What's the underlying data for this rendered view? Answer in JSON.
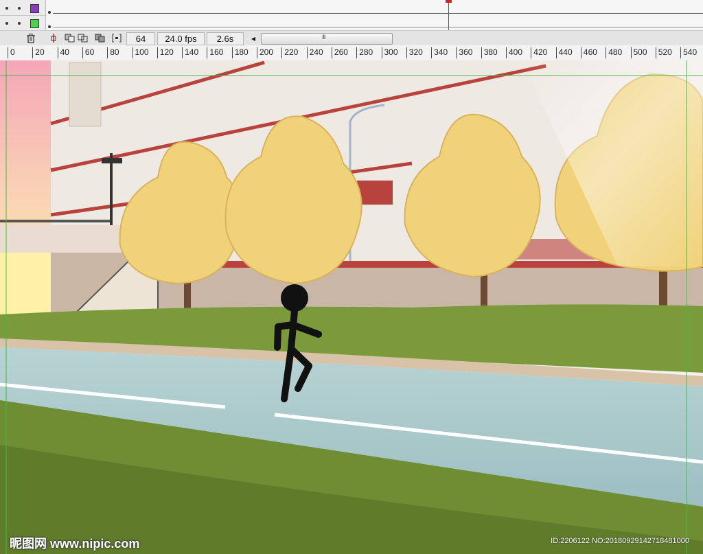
{
  "timeline": {
    "layers": [
      {
        "color": "#8b3bbd"
      },
      {
        "color": "#4bd34b"
      }
    ],
    "current_frame": "64",
    "frame_rate": "24.0 fps",
    "elapsed_time": "2.6s",
    "scroll_left_arrow": "◂",
    "scroll_grip": "III",
    "icons": [
      "trash-icon",
      "onion-center-icon",
      "onion-skin-icon",
      "onion-outline-icon",
      "edit-multiple-icon",
      "onion-markers-icon"
    ]
  },
  "ruler": {
    "labels": [
      "0",
      "20",
      "40",
      "60",
      "80",
      "100",
      "120",
      "140",
      "160",
      "180",
      "200",
      "220",
      "240",
      "260",
      "280",
      "300",
      "320",
      "340",
      "360",
      "380",
      "400",
      "420",
      "440",
      "460",
      "480",
      "500",
      "520",
      "540"
    ]
  },
  "watermark": {
    "site": "昵图网 www.nipic.com",
    "id": "ID:2206122 NO:20180929142718481000"
  },
  "colors": {
    "grass": "#7a9a3c",
    "road": "#a9c7ca",
    "tree": "#f0d27a",
    "stage_guide": "#3fbf3f"
  }
}
